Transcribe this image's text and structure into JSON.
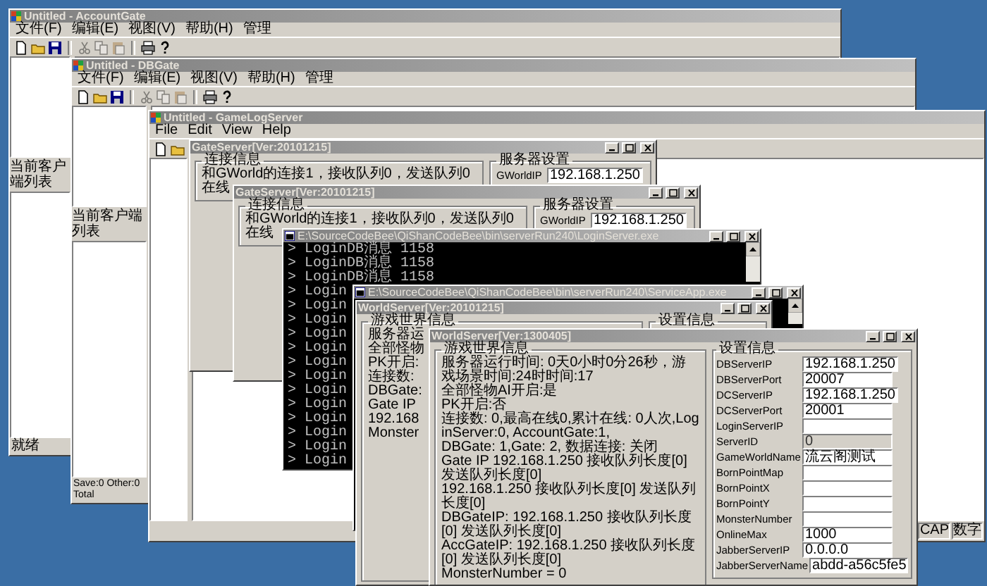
{
  "windows": [
    {
      "kind": "mfc",
      "title": "Untitled - AccountGate",
      "menu": [
        "文件(F)",
        "编辑(E)",
        "视图(V)",
        "帮助(H)",
        "管理"
      ],
      "toolbar": [
        {
          "kind": "new",
          "disabled": false
        },
        {
          "kind": "open",
          "disabled": false
        },
        {
          "kind": "save",
          "disabled": false
        },
        {
          "kind": "cut",
          "disabled": true
        },
        {
          "kind": "copy",
          "disabled": true
        },
        {
          "kind": "paste",
          "disabled": true
        },
        {
          "kind": "print",
          "disabled": false
        },
        {
          "kind": "help",
          "disabled": false
        }
      ],
      "list_label": "当前客户端列表",
      "status": "就绪"
    },
    {
      "kind": "mfc",
      "title": "Untitled - DBGate",
      "menu": [
        "文件(F)",
        "编辑(E)",
        "视图(V)",
        "帮助(H)",
        "管理"
      ],
      "toolbar": [
        {
          "kind": "new",
          "disabled": false
        },
        {
          "kind": "open",
          "disabled": false
        },
        {
          "kind": "save",
          "disabled": false
        },
        {
          "kind": "cut",
          "disabled": true
        },
        {
          "kind": "copy",
          "disabled": true
        },
        {
          "kind": "paste",
          "disabled": true
        },
        {
          "kind": "print",
          "disabled": false
        },
        {
          "kind": "help",
          "disabled": false
        }
      ],
      "list_label": "当前客户端列表",
      "status": "Save:0 Other:0 Total"
    },
    {
      "kind": "mfc",
      "title": "Untitled - GameLogServer",
      "menu": [
        "File",
        "Edit",
        "View",
        "Help"
      ],
      "toolbar": [
        {
          "kind": "new",
          "disabled": false
        },
        {
          "kind": "open",
          "disabled": false
        }
      ],
      "status_panes": [
        "CAP",
        "数字"
      ]
    },
    {
      "kind": "gate",
      "title": "GateServer[Ver:20101215]",
      "info_group": "连接信息",
      "info_lines": [
        "和GWorld的连接1，接收队列0，发送队列0",
        "在线"
      ],
      "settings_group": "服务器设置",
      "fields": [
        {
          "label": "GWorldIP",
          "value": "192.168.1.250",
          "disabled": false
        }
      ]
    },
    {
      "kind": "gate",
      "title": "GateServer[Ver:20101215]",
      "info_group": "连接信息",
      "info_lines": [
        "和GWorld的连接1，接收队列0，发送队列0",
        "在线"
      ],
      "settings_group": "服务器设置",
      "fields": [
        {
          "label": "GWorldIP",
          "value": "192.168.1.250",
          "disabled": false
        }
      ]
    },
    {
      "kind": "console",
      "title": "E:\\SourceCodeBee\\QiShanCodeBee\\bin\\serverRun240\\LoginServer.exe",
      "lines": [
        "> LoginDB消息 1158",
        "> LoginDB消息 1158",
        "> LoginDB消息 1158",
        "> Login",
        "> Login",
        "> Login",
        "> Login",
        "> Login",
        "> Login",
        "> Login",
        "> Login",
        "> Login",
        "> Login",
        "> Login",
        "> Login",
        "> Login"
      ]
    },
    {
      "kind": "console",
      "title": "E:\\SourceCodeBee\\QiShanCodeBee\\bin\\serverRun240\\ServiceApp.exe"
    },
    {
      "kind": "world",
      "title": "WorldServer[Ver:20101215]",
      "info_group": "游戏世界信息",
      "info_lines": [
        "服务器运",
        "全部怪物",
        "PK开启:",
        "连接数:",
        "DBGate:",
        "Gate IP",
        "192.168",
        "Monster"
      ],
      "settings_group": "设置信息"
    },
    {
      "kind": "world",
      "title": "WorldServer[Ver:1300405]",
      "info_group": "游戏世界信息",
      "info_lines": [
        "服务器运行时间: 0天0小时0分26秒，游戏场景时间:24时时间:17",
        "全部怪物AI开启:是",
        "PK开启:否",
        "连接数: 0,最高在线0,累计在线: 0人次,LoginServer:0, AccountGate:1,",
        "DBGate: 1,Gate: 2, 数据连接: 关闭",
        "Gate IP 192.168.1.250 接收队列长度[0] 发送队列长度[0]",
        "192.168.1.250 接收队列长度[0] 发送队列长度[0]",
        "DBGateIP: 192.168.1.250 接收队列长度[0] 发送队列长度[0]",
        "AccGateIP: 192.168.1.250 接收队列长度[0] 发送队列长度[0]",
        "MonsterNumber = 0"
      ],
      "settings_group": "设置信息",
      "fields": [
        {
          "label": "DBServerIP",
          "value": "192.168.1.250",
          "disabled": false
        },
        {
          "label": "DBServerPort",
          "value": "20007",
          "disabled": false
        },
        {
          "label": "DCServerIP",
          "value": "192.168.1.250",
          "disabled": false
        },
        {
          "label": "DCServerPort",
          "value": "20001",
          "disabled": false
        },
        {
          "label": "LoginServerIP",
          "disabled": false
        },
        {
          "label": "ServerID",
          "value": "0",
          "disabled": true
        },
        {
          "label": "GameWorldName",
          "value": "流云阁测试",
          "disabled": false
        },
        {
          "label": "BornPointMap",
          "disabled": false
        },
        {
          "label": "BornPointX",
          "disabled": false
        },
        {
          "label": "BornPointY",
          "disabled": false
        },
        {
          "label": "MonsterNumber",
          "disabled": false
        },
        {
          "label": "OnlineMax",
          "value": "1000",
          "disabled": false
        },
        {
          "label": "JabberServerIP",
          "value": "0.0.0.0",
          "disabled": false
        },
        {
          "label": "JabberServerName",
          "value": "abdd-a56c5fe5",
          "disabled": false
        }
      ]
    }
  ]
}
